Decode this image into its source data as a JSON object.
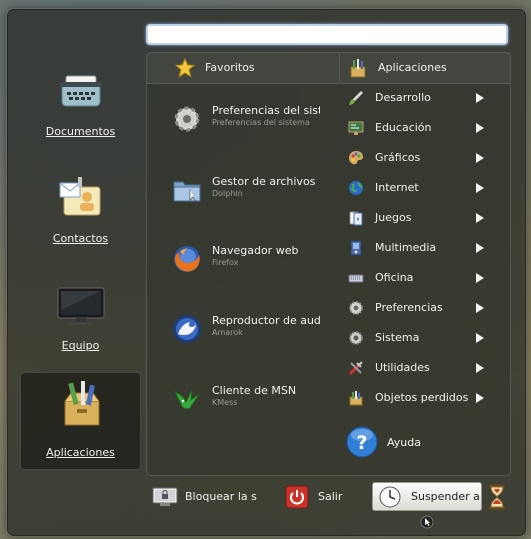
{
  "search": {
    "placeholder": ""
  },
  "places": [
    {
      "label": "Documentos",
      "icon": "typewriter-icon"
    },
    {
      "label": "Contactos",
      "icon": "contacts-icon"
    },
    {
      "label": "Equipo",
      "icon": "computer-monitor-icon"
    },
    {
      "label": "Aplicaciones",
      "icon": "applications-box-icon"
    }
  ],
  "favorites_header": "Favoritos",
  "applications_header": "Aplicaciones",
  "favorites": [
    {
      "name": "Preferencias del sistema",
      "sub": "Preferencias del sistema",
      "icon": "gear-icon"
    },
    {
      "name": "Gestor de archivos",
      "sub": "Dolphin",
      "icon": "folder-icon"
    },
    {
      "name": "Navegador web",
      "sub": "Firefox",
      "icon": "firefox-icon"
    },
    {
      "name": "Reproductor de audio",
      "sub": "Amarok",
      "icon": "amarok-icon"
    },
    {
      "name": "Cliente de MSN",
      "sub": "KMess",
      "icon": "kmess-bird-icon"
    }
  ],
  "categories": [
    {
      "label": "Desarrollo",
      "icon": "brush-icon"
    },
    {
      "label": "Educación",
      "icon": "blackboard-icon"
    },
    {
      "label": "Gráficos",
      "icon": "palette-icon"
    },
    {
      "label": "Internet",
      "icon": "globe-icon"
    },
    {
      "label": "Juegos",
      "icon": "cards-icon"
    },
    {
      "label": "Multimedia",
      "icon": "multimedia-icon"
    },
    {
      "label": "Oficina",
      "icon": "keyboard-icon"
    },
    {
      "label": "Preferencias",
      "icon": "gear-icon"
    },
    {
      "label": "Sistema",
      "icon": "gear-icon"
    },
    {
      "label": "Utilidades",
      "icon": "tools-icon"
    },
    {
      "label": "Objetos perdidos",
      "icon": "box-icon"
    }
  ],
  "help_label": "Ayuda",
  "bottom": {
    "lock_label": "Bloquear la s",
    "logout_label": "Salir",
    "suspend_label": "Suspender a"
  },
  "colors": {
    "panel_bg": "#262822",
    "text": "#f2f2ee",
    "subtext": "#9a9c92",
    "help_blue": "#2f7fd6",
    "logout_red": "#c9332a"
  }
}
